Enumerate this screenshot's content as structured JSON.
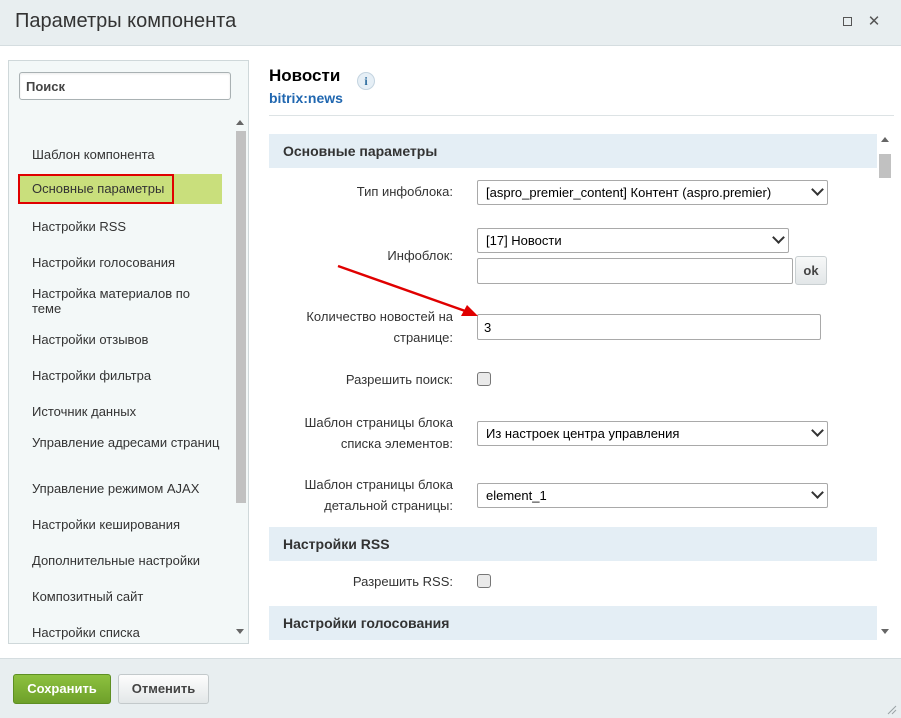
{
  "window": {
    "title": "Параметры компонента",
    "maximize_icon": "maximize-icon",
    "close_icon": "close-icon",
    "close_glyph": "✕"
  },
  "sidebar": {
    "search_placeholder": "Поиск",
    "items": [
      {
        "label": "Шаблон компонента",
        "active": false
      },
      {
        "label": "Основные параметры",
        "active": true
      },
      {
        "label": "Настройки RSS",
        "active": false
      },
      {
        "label": "Настройки голосования",
        "active": false
      },
      {
        "label": "Настройка материалов по теме",
        "active": false
      },
      {
        "label": "Настройки отзывов",
        "active": false
      },
      {
        "label": "Настройки фильтра",
        "active": false
      },
      {
        "label": "Источник данных",
        "active": false
      },
      {
        "label": "Управление адресами страниц",
        "active": false
      },
      {
        "label": "Управление режимом AJAX",
        "active": false
      },
      {
        "label": "Настройки кеширования",
        "active": false
      },
      {
        "label": "Дополнительные настройки",
        "active": false
      },
      {
        "label": "Композитный сайт",
        "active": false
      },
      {
        "label": "Настройки списка",
        "active": false
      }
    ]
  },
  "component": {
    "name": "Новости",
    "code": "bitrix:news",
    "info_glyph": "i"
  },
  "sections": {
    "main": {
      "title": "Основные параметры",
      "iblock_type": {
        "label": "Тип инфоблока:",
        "value": "[aspro_premier_content] Контент (aspro.premier)"
      },
      "iblock": {
        "label": "Инфоблок:",
        "value": "[17] Новости",
        "extra_value": "",
        "ok_label": "ok"
      },
      "news_count": {
        "label": "Количество новостей на странице:",
        "value": "3"
      },
      "allow_search": {
        "label": "Разрешить поиск:",
        "checked": false
      },
      "list_template": {
        "label": "Шаблон страницы блока списка элементов:",
        "value": "Из настроек центра управления"
      },
      "detail_template": {
        "label": "Шаблон страницы блока детальной страницы:",
        "value": "element_1"
      }
    },
    "rss": {
      "title": "Настройки RSS",
      "allow_rss": {
        "label": "Разрешить RSS:",
        "checked": false
      }
    },
    "voting": {
      "title": "Настройки голосования"
    }
  },
  "footer": {
    "save_label": "Сохранить",
    "cancel_label": "Отменить"
  },
  "colors": {
    "accent_green": "#7ab032",
    "active_item_bg": "#c9df7c",
    "annotation_red": "#e00000",
    "link_blue": "#2067b0"
  }
}
